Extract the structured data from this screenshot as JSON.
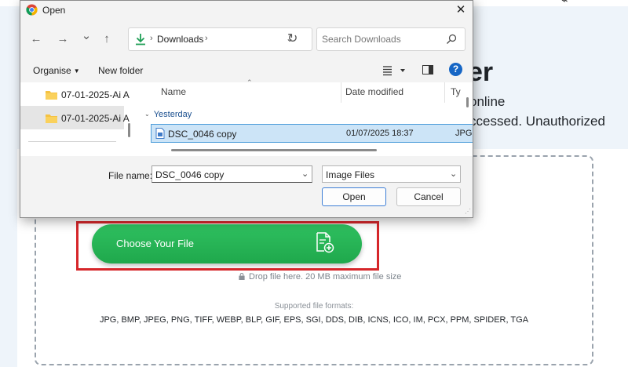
{
  "dialog": {
    "title": "Open",
    "close_glyph": "✕",
    "nav": {
      "back_glyph": "←",
      "forward_glyph": "→",
      "recent_glyph": "⌄",
      "up_glyph": "↑",
      "breadcrumb_sep": "›",
      "location": "Downloads",
      "location_icon": "download-arrow-icon",
      "dropdown_glyph": "⌄",
      "refresh_glyph": "↻"
    },
    "search": {
      "placeholder": "Search Downloads"
    },
    "commands": {
      "organise": "Organise",
      "organise_caret": "▼",
      "new_folder": "New folder",
      "view_caret": "▼",
      "help_glyph": "?"
    },
    "nav_pane": {
      "items": [
        {
          "label": "07-01-2025-Ai A",
          "icon": "folder-icon",
          "selected": false
        },
        {
          "label": "07-01-2025-Ai A",
          "icon": "folder-icon",
          "selected": true
        }
      ]
    },
    "file_list": {
      "columns": [
        "Name",
        "Date modified",
        "Ty"
      ],
      "sort_glyph": "⌃",
      "group_chevron": "⌄",
      "group": "Yesterday",
      "files": [
        {
          "name": "DSC_0046 copy",
          "date_modified": "01/07/2025 18:37",
          "type": "JPG",
          "icon": "image-file-icon",
          "selected": true
        }
      ]
    },
    "bottom": {
      "file_name_label": "File name:",
      "file_name_value": "DSC_0046 copy",
      "file_name_chevron": "⌄",
      "file_type": "Image Files",
      "file_type_chevron": "⌄",
      "open_label": "Open",
      "cancel_label": "Cancel",
      "grip_glyph": "⋰"
    },
    "accent_color": "#1666c5",
    "selection_color": "#cce4f7"
  },
  "page": {
    "top_glyph": "⌁",
    "title_fragment": "er",
    "text_fragment_1": "online",
    "text_fragment_2": "ccessed. Unauthorized",
    "upload": {
      "button_label": "Choose Your File",
      "button_color": "#22b14c",
      "button_icon": "add-file-icon",
      "drop_note": "Drop file here. 20 MB maximum file size",
      "drop_note_icon": "lock-icon",
      "formats_title": "Supported file formats:",
      "formats": "JPG, BMP, JPEG, PNG, TIFF, WEBP, BLP, GIF, EPS, SGI, DDS, DIB, ICNS, ICO, IM, PCX, PPM, SPIDER, TGA"
    },
    "highlight_color": "#d6262a"
  }
}
